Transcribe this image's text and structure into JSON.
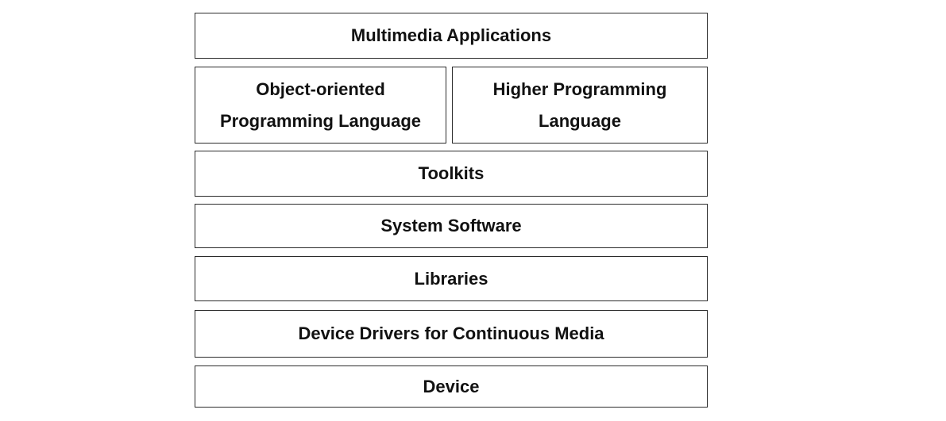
{
  "diagram": {
    "layers": {
      "applications": "Multimedia Applications",
      "object_oriented": [
        "Object-oriented",
        "Programming Language"
      ],
      "higher_programming": [
        "Higher Programming",
        "Language"
      ],
      "toolkits": "Toolkits",
      "system_software": "System Software",
      "libraries": "Libraries",
      "device_drivers": "Device Drivers for Continuous Media",
      "device": "Device"
    }
  }
}
